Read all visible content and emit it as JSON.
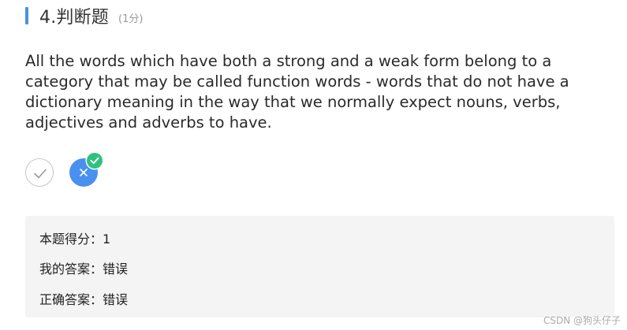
{
  "question": {
    "title": "4.判断题",
    "score": "(1分)",
    "text": "All the words which have both a strong and a weak form belong to a category that may be called function words - words that do not have a dictionary meaning in the way that we normally expect nouns, verbs, adjectives and adverbs to have."
  },
  "options": [
    {
      "name": "true-option",
      "icon": "check-icon",
      "selected": false
    },
    {
      "name": "false-option",
      "icon": "close-icon",
      "selected": true
    }
  ],
  "selected_badge_icon": "check-icon",
  "colors": {
    "accent": "#4a90e2",
    "selected_option": "#4a90f0",
    "correct_badge": "#2ec27e",
    "answer_panel": "#f4f4f4"
  },
  "result": {
    "score_line": "本题得分：1",
    "my_answer_line": "我的答案：错误",
    "correct_answer_line": "正确答案：错误"
  },
  "watermark": "CSDN @狗头仔子"
}
